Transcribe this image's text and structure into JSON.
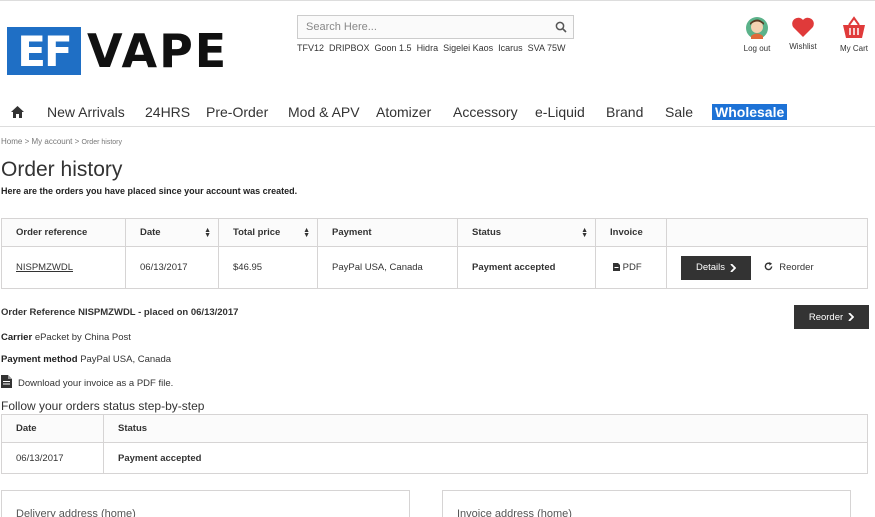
{
  "logo": {
    "box_text": "EF",
    "text": "VAPE"
  },
  "search": {
    "placeholder": "Search Here..."
  },
  "tags": [
    "TFV12",
    "DRIPBOX",
    "Goon 1.5",
    "Hidra",
    "Sigelei Kaos",
    "Icarus",
    "SVA 75W"
  ],
  "header_icons": {
    "logout": "Log out",
    "wishlist": "Wishlist",
    "cart": "My Cart"
  },
  "nav": [
    "New Arrivals",
    "24HRS",
    "Pre-Order",
    "Mod & APV",
    "Atomizer",
    "Accessory",
    "e-Liquid",
    "Brand",
    "Sale",
    "Wholesale"
  ],
  "breadcrumb": {
    "home": "Home",
    "account": "My account",
    "current": "Order history",
    "sep": ">"
  },
  "page": {
    "title": "Order history",
    "subtitle": "Here are the orders you have placed since your account was created."
  },
  "orders_table": {
    "headers": [
      "Order reference",
      "Date",
      "Total price",
      "Payment",
      "Status",
      "Invoice"
    ],
    "rows": [
      {
        "reference": "NISPMZWDL",
        "date": "06/13/2017",
        "total": "$46.95",
        "payment": "PayPal USA, Canada",
        "status": "Payment accepted",
        "invoice": "PDF",
        "details": "Details",
        "reorder": "Reorder"
      }
    ]
  },
  "order_detail": {
    "heading": "Order Reference NISPMZWDL - placed on 06/13/2017",
    "reorder_button": "Reorder",
    "carrier_label": "Carrier",
    "carrier_value": "ePacket by China Post",
    "payment_label": "Payment method",
    "payment_value": "PayPal USA, Canada",
    "download_text": "Download your invoice as a PDF file.",
    "follow_title": "Follow your orders status step-by-step"
  },
  "status_table": {
    "headers": [
      "Date",
      "Status"
    ],
    "rows": [
      {
        "date": "06/13/2017",
        "status": "Payment accepted"
      }
    ]
  },
  "addresses": {
    "delivery": "Delivery address (home)",
    "invoice": "Invoice address (home)"
  },
  "colors": {
    "brand_blue": "#1f6fc5",
    "wholesale_blue": "#1d72d6",
    "dark_button": "#333333",
    "heart_red": "#e03a3a"
  },
  "icons": [
    "search-icon",
    "avatar-icon",
    "heart-icon",
    "cart-icon",
    "home-icon",
    "sort-icon",
    "pdf-icon",
    "chevron-right-icon",
    "refresh-icon",
    "file-icon"
  ]
}
